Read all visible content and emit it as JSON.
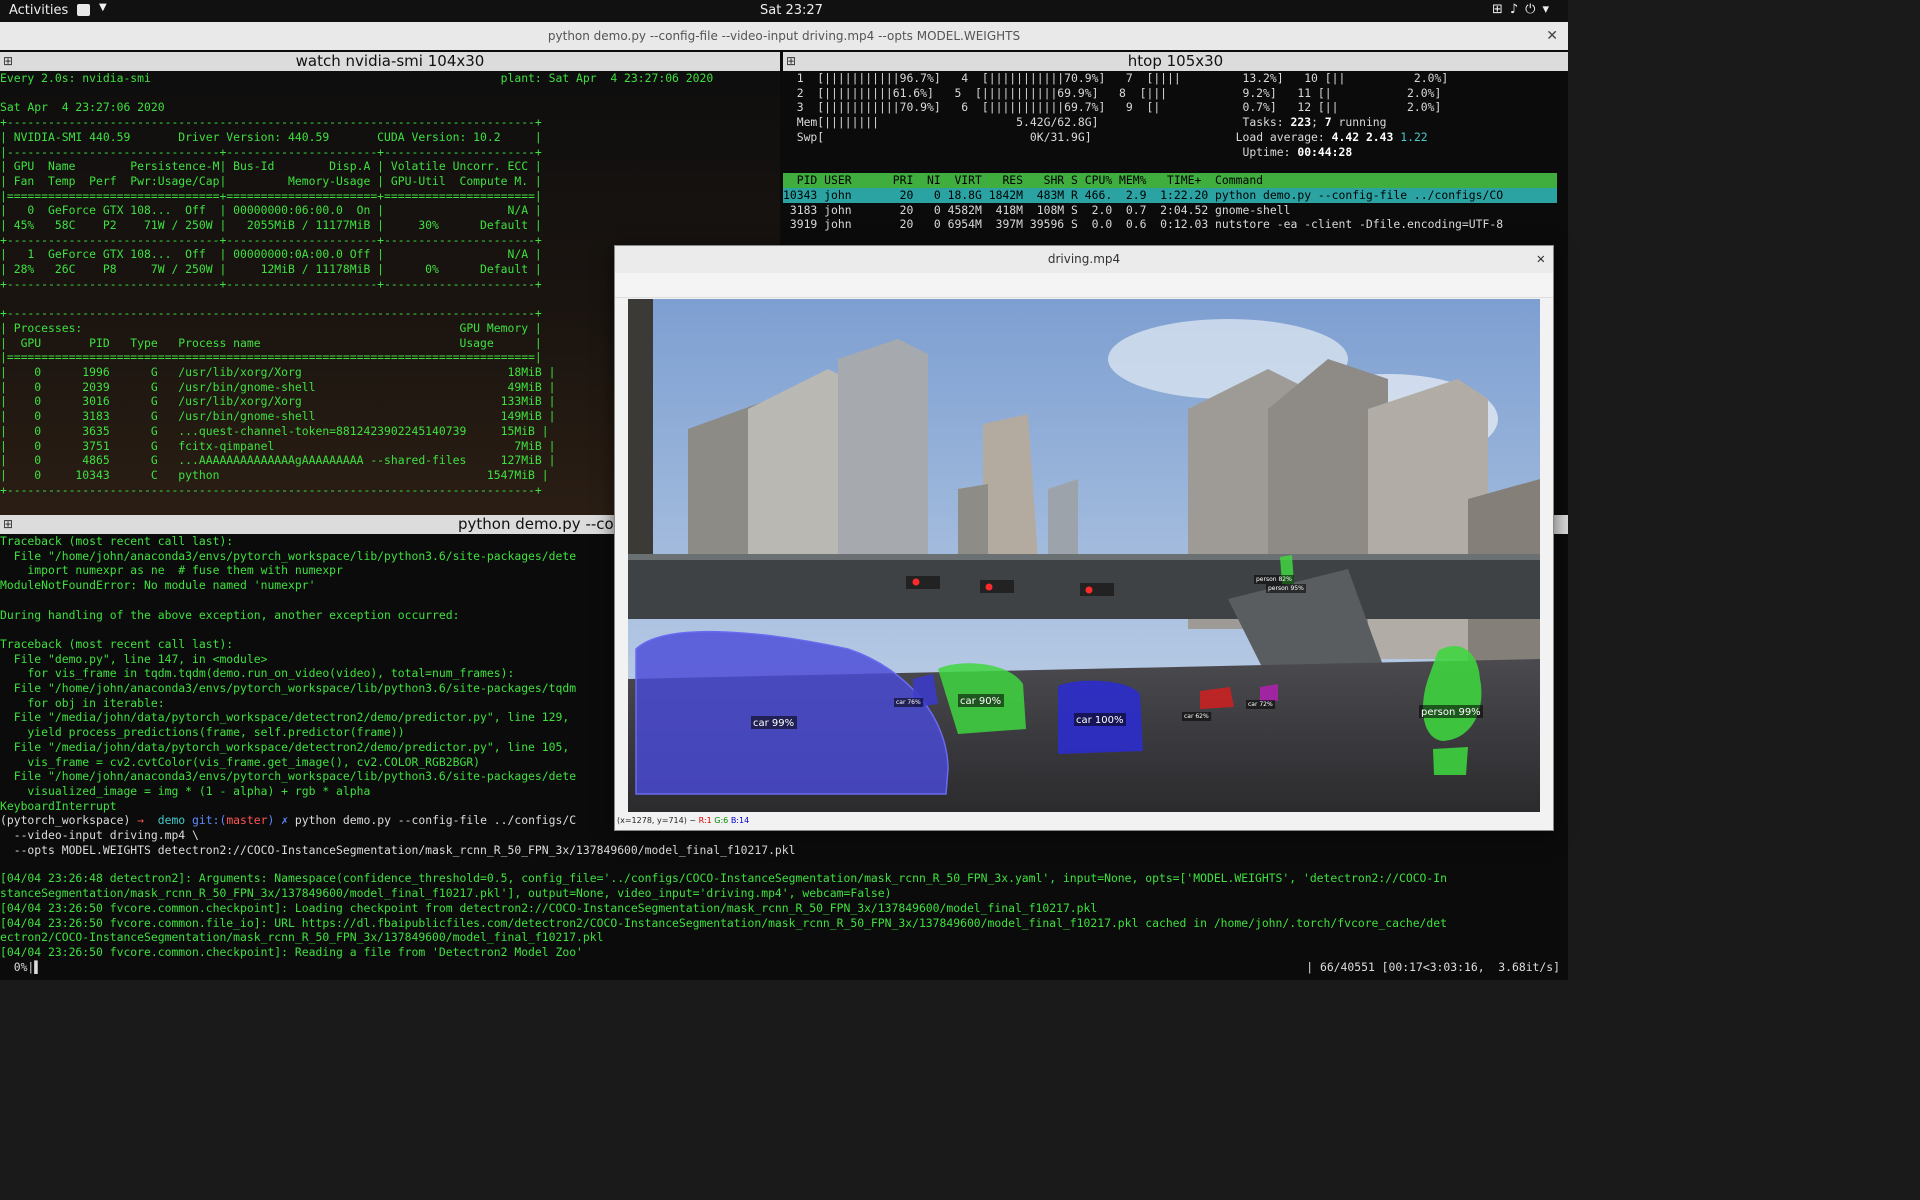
{
  "topbar": {
    "activities": "Activities",
    "clock": "Sat 23:27"
  },
  "window": {
    "title": "python demo.py --config-file  --video-input driving.mp4 --opts MODEL.WEIGHTS"
  },
  "panes": {
    "nvidia": {
      "title": "watch nvidia-smi 104x30"
    },
    "htop": {
      "title": "htop 105x30"
    },
    "term": {
      "title": "python demo.py --co"
    }
  },
  "nvidia_smi": {
    "lines": [
      "Every 2.0s: nvidia-smi                                                   plant: Sat Apr  4 23:27:06 2020",
      "",
      "Sat Apr  4 23:27:06 2020",
      "+-----------------------------------------------------------------------------+",
      "| NVIDIA-SMI 440.59       Driver Version: 440.59       CUDA Version: 10.2     |",
      "|-------------------------------+----------------------+----------------------+",
      "| GPU  Name        Persistence-M| Bus-Id        Disp.A | Volatile Uncorr. ECC |",
      "| Fan  Temp  Perf  Pwr:Usage/Cap|         Memory-Usage | GPU-Util  Compute M. |",
      "|===============================+======================+======================|",
      "|   0  GeForce GTX 108...  Off  | 00000000:06:00.0  On |                  N/A |",
      "| 45%   58C    P2    71W / 250W |   2055MiB / 11177MiB |     30%      Default |",
      "+-------------------------------+----------------------+----------------------+",
      "|   1  GeForce GTX 108...  Off  | 00000000:0A:00.0 Off |                  N/A |",
      "| 28%   26C    P8     7W / 250W |     12MiB / 11178MiB |      0%      Default |",
      "+-------------------------------+----------------------+----------------------+",
      "",
      "+-----------------------------------------------------------------------------+",
      "| Processes:                                                       GPU Memory |",
      "|  GPU       PID   Type   Process name                             Usage      |",
      "|=============================================================================|",
      "|    0      1996      G   /usr/lib/xorg/Xorg                              18MiB |",
      "|    0      2039      G   /usr/bin/gnome-shell                            49MiB |",
      "|    0      3016      G   /usr/lib/xorg/Xorg                             133MiB |",
      "|    0      3183      G   /usr/bin/gnome-shell                           149MiB |",
      "|    0      3635      G   ...quest-channel-token=8812423902245140739     15MiB |",
      "|    0      3751      G   fcitx-qimpanel                                   7MiB |",
      "|    0      4865      G   ...AAAAAAAAAAAAAAgAAAAAAAAA --shared-files     127MiB |",
      "|    0     10343      C   python                                       1547MiB |",
      "+-----------------------------------------------------------------------------+"
    ]
  },
  "htop": {
    "cpu_lines": [
      "  1  [|||||||||||96.7%]   4  [|||||||||||70.9%]   7  [||||         13.2%]   10 [||          2.0%]",
      "  2  [||||||||||61.6%]   5  [|||||||||||69.9%]   8  [|||           9.2%]   11 [|           2.0%]",
      "  3  [|||||||||||70.9%]   6  [|||||||||||69.7%]   9  [|            0.7%]   12 [||          2.0%]"
    ],
    "mem_line": "  Mem[||||||||                    5.42G/62.8G]",
    "swp_line": "  Swp[                              0K/31.9G]",
    "tasks_label": "Tasks: ",
    "tasks_count": "223",
    "running_count": "7",
    "running_label": " running",
    "load_label": "Load average: ",
    "load1": "4.42",
    "load5": "2.43",
    "load15": "1.22",
    "uptime_label": "Uptime: ",
    "uptime": "00:44:28",
    "header": "  PID USER      PRI  NI  VIRT   RES   SHR S CPU% MEM%   TIME+  Command                               ",
    "rows": [
      "10343 john       20   0 18.8G 1842M  483M R 466.  2.9  1:22.20 python demo.py --config-file ../configs/CO",
      " 3183 john       20   0 4582M  418M  108M S  2.0  0.7  2:04.52 gnome-shell",
      " 3919 john       20   0 6954M  397M 39596 S  0.0  0.6  0:12.03 nutstore -ea -client -Dfile.encoding=UTF-8"
    ]
  },
  "terminal": {
    "lines": [
      "Traceback (most recent call last):",
      "  File \"/home/john/anaconda3/envs/pytorch_workspace/lib/python3.6/site-packages/dete",
      "    import numexpr as ne  # fuse them with numexpr",
      "ModuleNotFoundError: No module named 'numexpr'",
      "",
      "During handling of the above exception, another exception occurred:",
      "",
      "Traceback (most recent call last):",
      "  File \"demo.py\", line 147, in <module>",
      "    for vis_frame in tqdm.tqdm(demo.run_on_video(video), total=num_frames):",
      "  File \"/home/john/anaconda3/envs/pytorch_workspace/lib/python3.6/site-packages/tqdm",
      "    for obj in iterable:",
      "  File \"/media/john/data/pytorch_workspace/detectron2/demo/predictor.py\", line 129,",
      "    yield process_predictions(frame, self.predictor(frame))",
      "  File \"/media/john/data/pytorch_workspace/detectron2/demo/predictor.py\", line 105,",
      "    vis_frame = cv2.cvtColor(vis_frame.get_image(), cv2.COLOR_RGB2BGR)",
      "  File \"/home/john/anaconda3/envs/pytorch_workspace/lib/python3.6/site-packages/dete",
      "    visualized_image = img * (1 - alpha) + rgb * alpha",
      "KeyboardInterrupt"
    ],
    "prompt_env": "(pytorch_workspace) ",
    "prompt_arrow": "→  ",
    "prompt_dir": "demo ",
    "prompt_git": "git:(",
    "prompt_branch": "master",
    "prompt_git_end": ") ✗ ",
    "prompt_cmd": "python demo.py --config-file ../configs/C",
    "cont_lines": [
      "  --video-input driving.mp4 \\",
      "  --opts MODEL.WEIGHTS detectron2://COCO-InstanceSegmentation/mask_rcnn_R_50_FPN_3x/137849600/model_final_f10217.pkl"
    ],
    "log_lines": [
      "[04/04 23:26:48 detectron2]: Arguments: Namespace(confidence_threshold=0.5, config_file='../configs/COCO-InstanceSegmentation/mask_rcnn_R_50_FPN_3x.yaml', input=None, opts=['MODEL.WEIGHTS', 'detectron2://COCO-In",
      "stanceSegmentation/mask_rcnn_R_50_FPN_3x/137849600/model_final_f10217.pkl'], output=None, video_input='driving.mp4', webcam=False)",
      "[04/04 23:26:50 fvcore.common.checkpoint]: Loading checkpoint from detectron2://COCO-InstanceSegmentation/mask_rcnn_R_50_FPN_3x/137849600/model_final_f10217.pkl",
      "[04/04 23:26:50 fvcore.common.file_io]: URL https://dl.fbaipublicfiles.com/detectron2/COCO-InstanceSegmentation/mask_rcnn_R_50_FPN_3x/137849600/model_final_f10217.pkl cached in /home/john/.torch/fvcore_cache/det",
      "ectron2/COCO-InstanceSegmentation/mask_rcnn_R_50_FPN_3x/137849600/model_final_f10217.pkl",
      "[04/04 23:26:50 fvcore.common.checkpoint]: Reading a file from 'Detectron2 Model Zoo'"
    ],
    "progress_left": "  0%|",
    "progress_right": "| 66/40551 [00:17<3:03:16,  3.68it/s]"
  },
  "video": {
    "title": "driving.mp4",
    "status_coords": "(x=1278, y=714) ~ ",
    "status_r": "R:1",
    "status_g": "G:6",
    "status_b": "B:14",
    "detections": [
      {
        "label": "car 99%",
        "color": "#4b4bd8"
      },
      {
        "label": "car 90%",
        "color": "#3fd63f"
      },
      {
        "label": "car 100%",
        "color": "#2b2bd0"
      },
      {
        "label": "person 99%",
        "color": "#3fd63f"
      },
      {
        "label": "car 76%",
        "color": "#3b3bcf"
      },
      {
        "label": "car 62%",
        "color": "#d02020"
      },
      {
        "label": "car 72%",
        "color": "#b020b0"
      },
      {
        "label": "person 82%",
        "color": "#3fd63f"
      },
      {
        "label": "person 95%",
        "color": "#3fd63f"
      }
    ]
  }
}
